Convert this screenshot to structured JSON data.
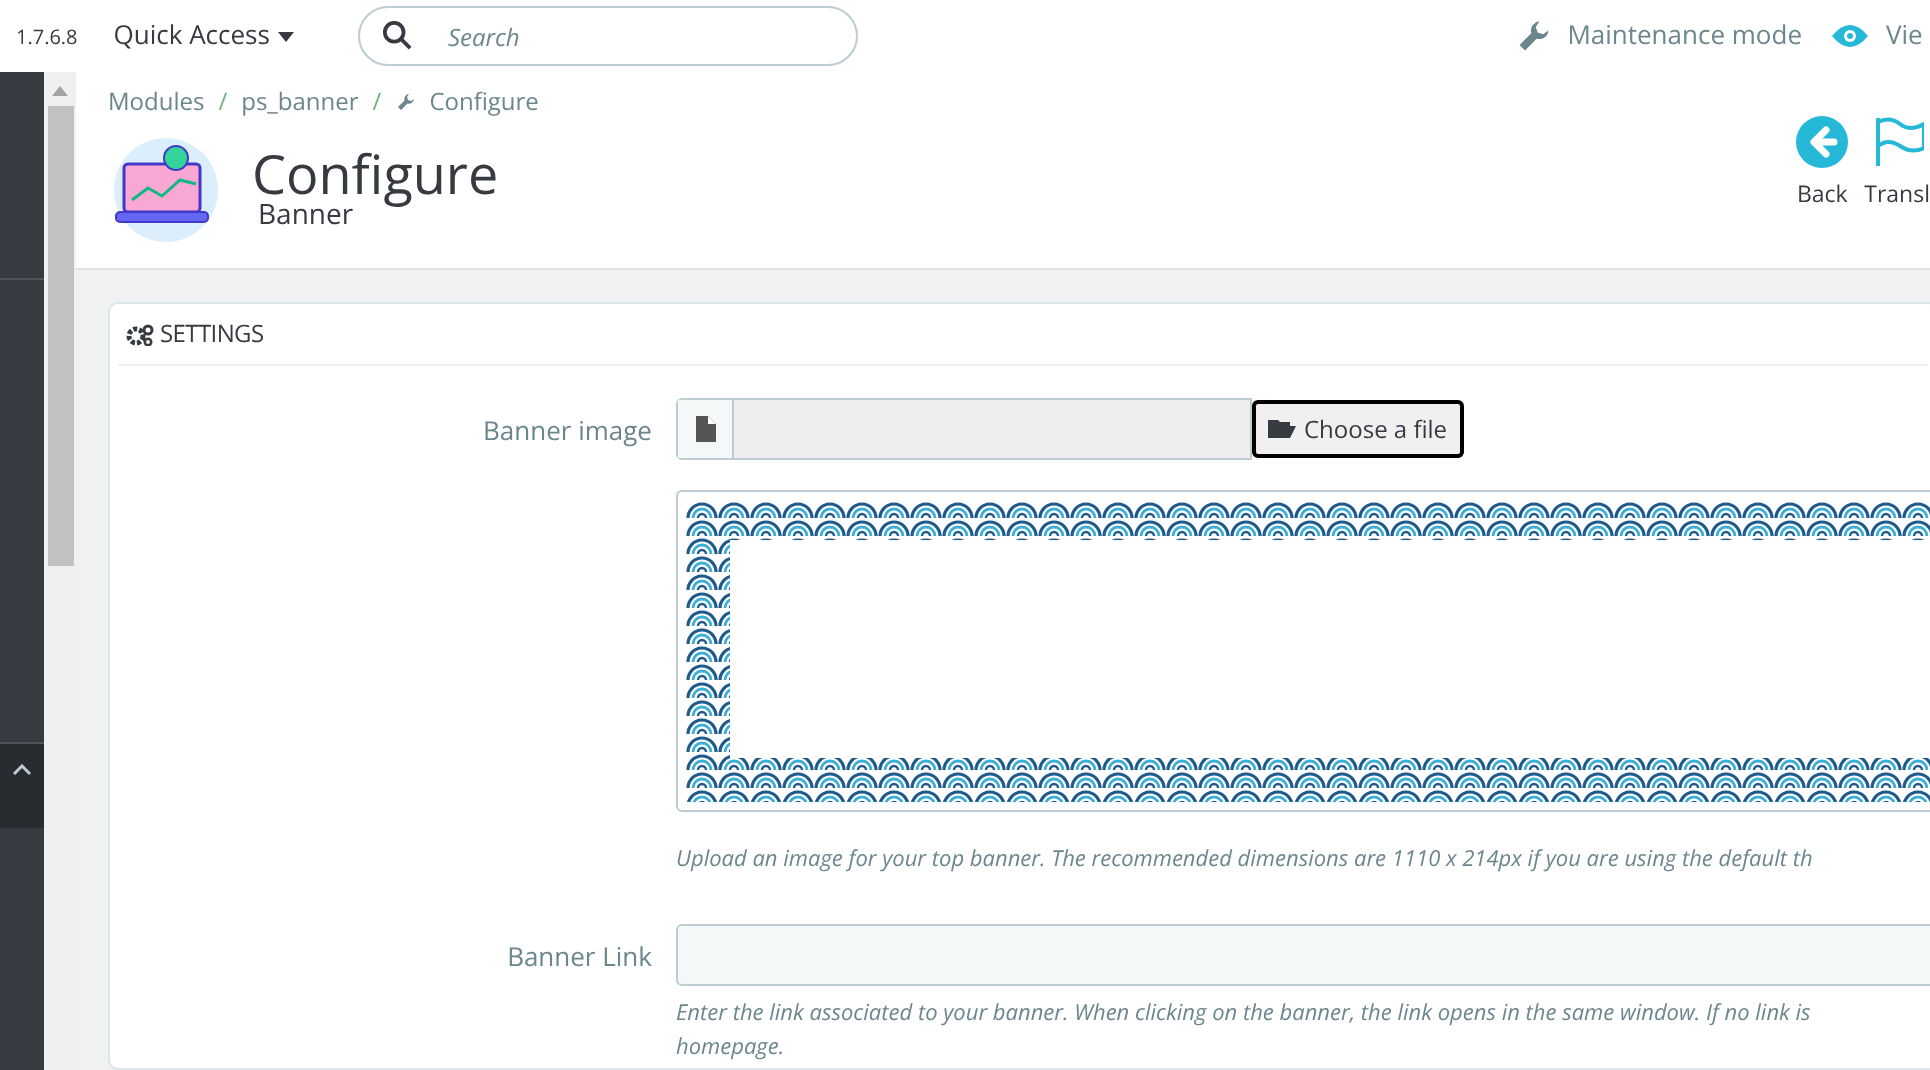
{
  "topbar": {
    "version": "1.7.6.8",
    "quick_access": "Quick Access",
    "search": {
      "placeholder": "Search"
    },
    "maintenance": "Maintenance mode",
    "view": "Vie"
  },
  "breadcrumb": [
    "Modules",
    "ps_banner",
    "Configure"
  ],
  "breadcrumb_separator": "/",
  "header": {
    "title": "Configure",
    "subtitle": "Banner",
    "actions": [
      {
        "kind": "back",
        "label": "Back"
      },
      {
        "kind": "translate",
        "label": "Transl"
      }
    ]
  },
  "panel": {
    "title": "SETTINGS",
    "banner_image": {
      "label": "Banner image",
      "button": "Choose a file",
      "help": "Upload an image for your top banner. The recommended dimensions are 1110 x 214px if you are using the default th"
    },
    "banner_link": {
      "label": "Banner Link",
      "help": "Enter the link associated to your banner. When clicking on the banner, the link opens in the same window. If no link is",
      "help_line_2": "homepage."
    }
  }
}
